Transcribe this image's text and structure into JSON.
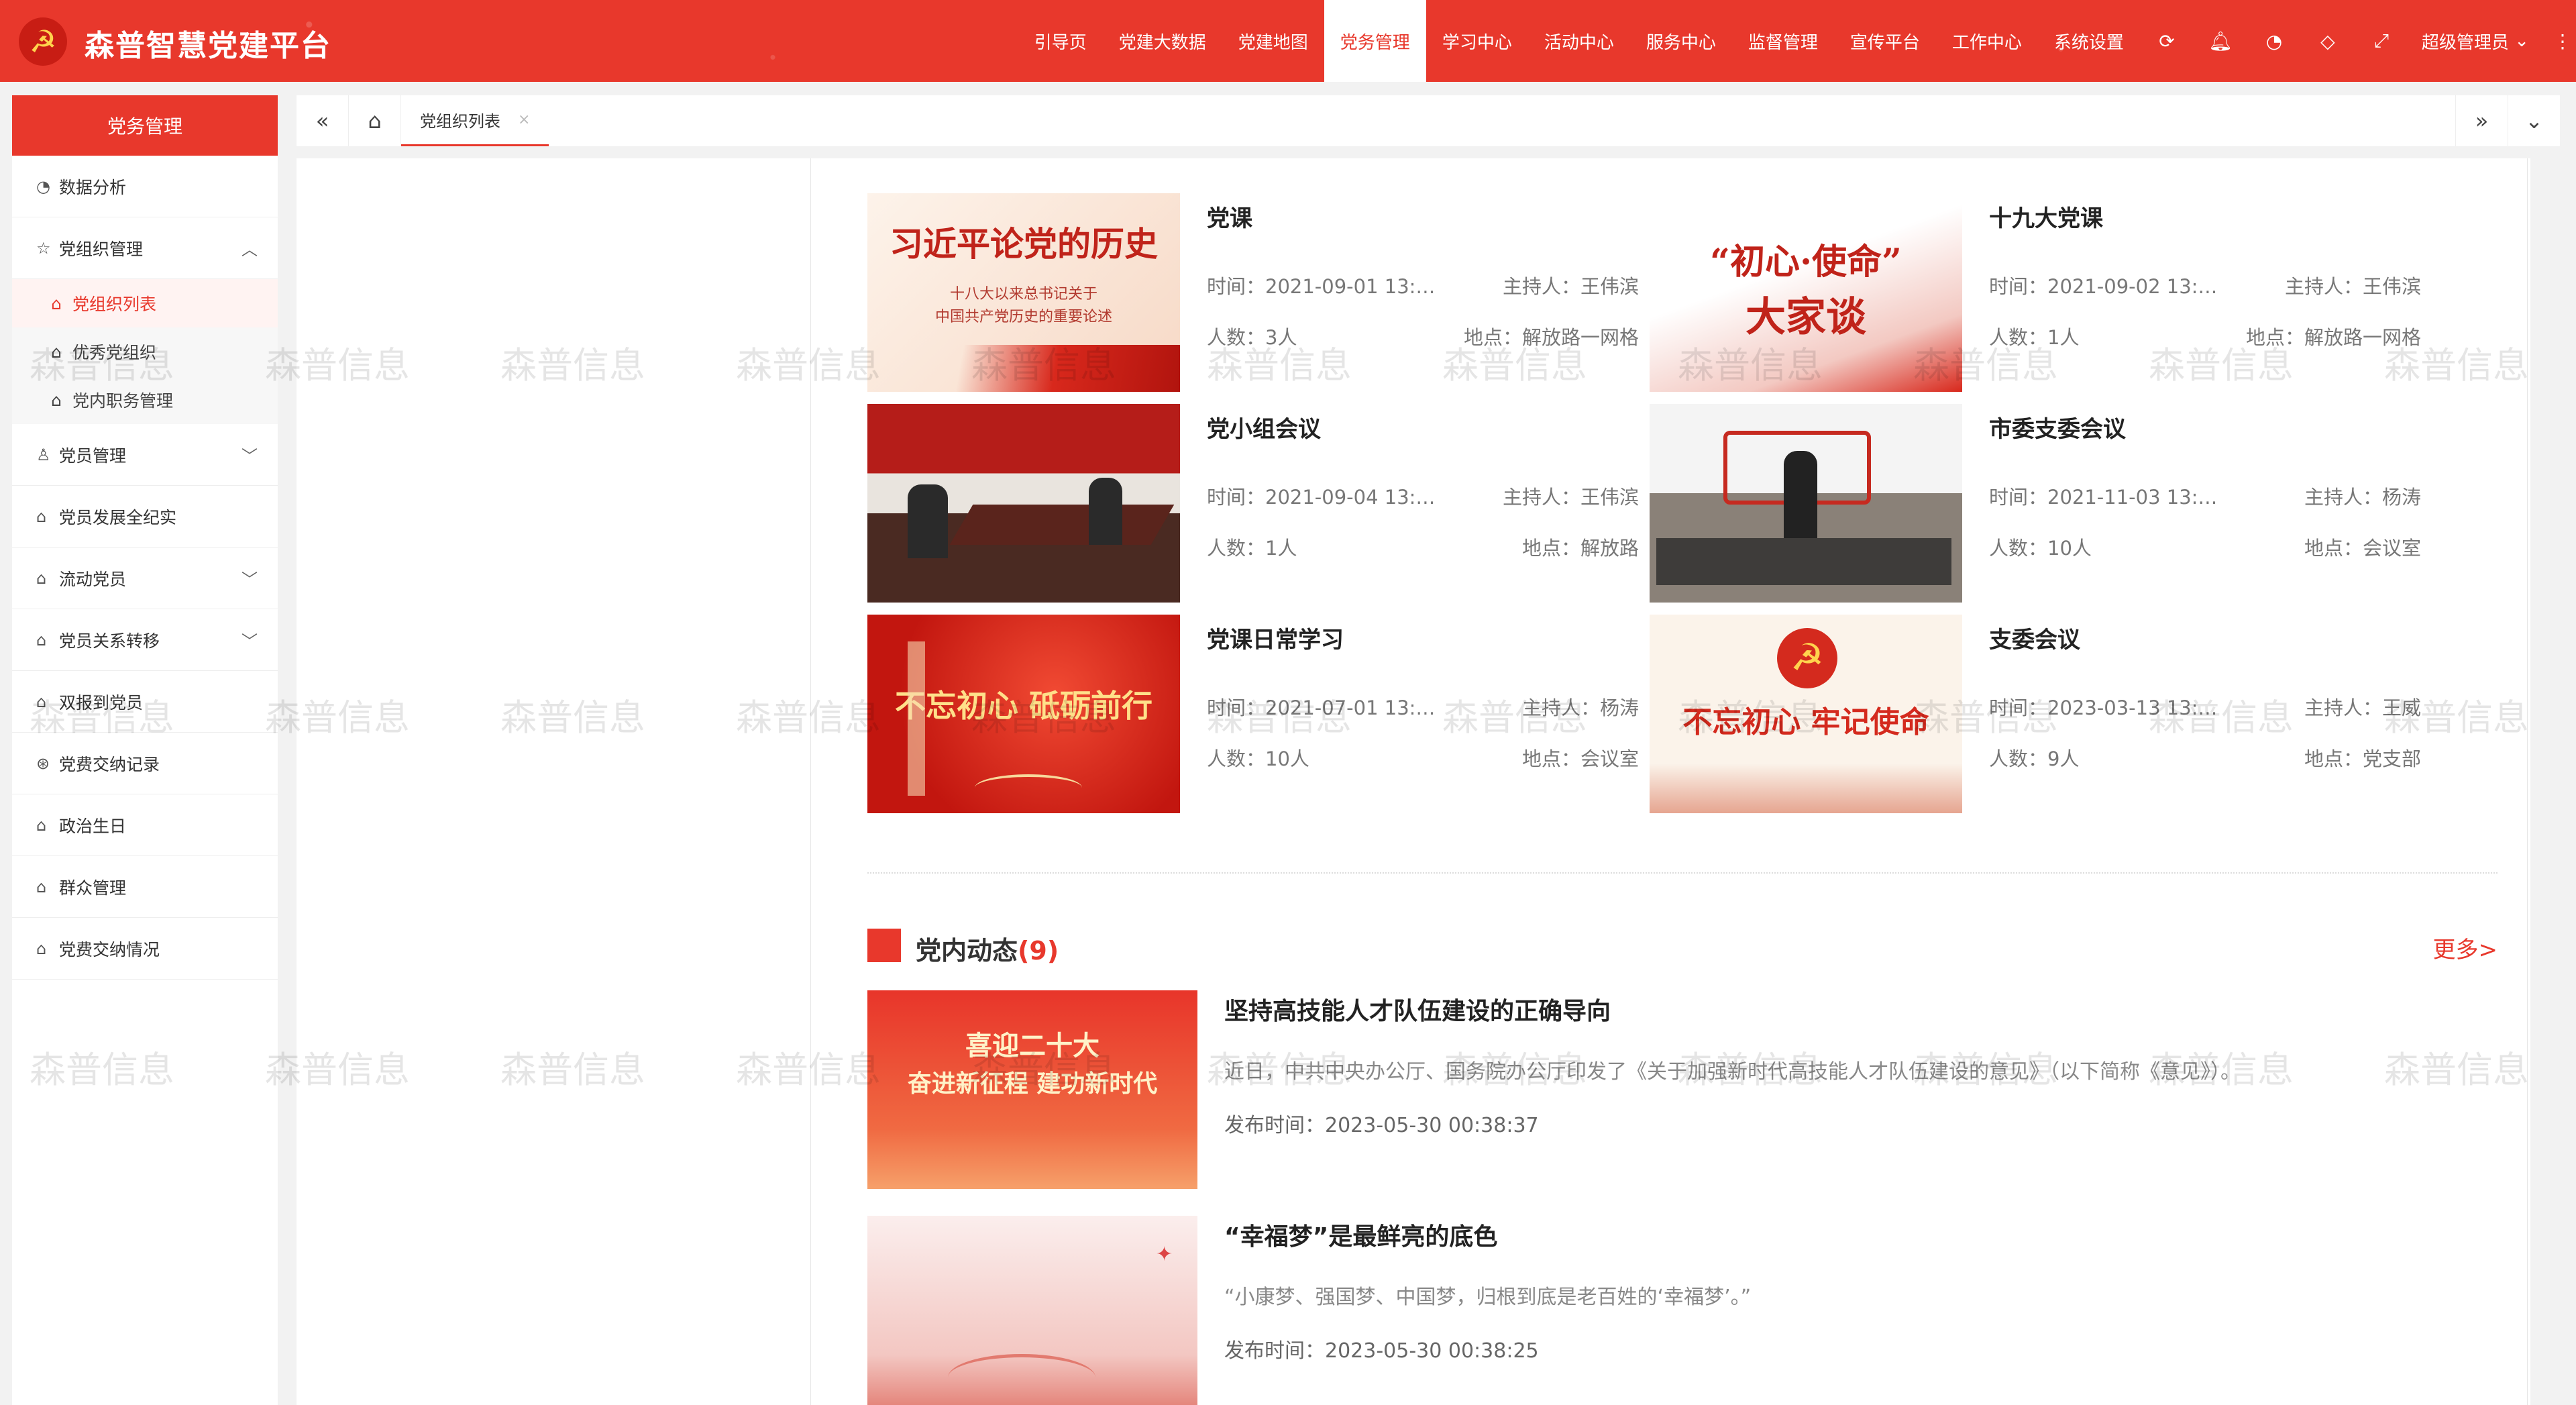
{
  "app": {
    "title": "森普智慧党建平台"
  },
  "topnav": {
    "items": [
      "引导页",
      "党建大数据",
      "党建地图",
      "党务管理",
      "学习中心",
      "活动中心",
      "服务中心",
      "监督管理",
      "宣传平台",
      "工作中心",
      "系统设置"
    ],
    "active": "党务管理",
    "icons": [
      "refresh-icon",
      "bell-icon",
      "palette-icon",
      "tag-icon",
      "fullscreen-icon"
    ],
    "user": "超级管理员"
  },
  "sidebar": {
    "header": "党务管理",
    "items": [
      {
        "label": "数据分析",
        "icon": "chart-icon"
      },
      {
        "label": "党组织管理",
        "icon": "star-icon",
        "expanded": true,
        "children": [
          {
            "label": "党组织列表",
            "active": true
          },
          {
            "label": "优秀党组织"
          },
          {
            "label": "党内职务管理"
          }
        ]
      },
      {
        "label": "党员管理",
        "icon": "person-icon",
        "chevron": true
      },
      {
        "label": "党员发展全纪实",
        "icon": "home-icon"
      },
      {
        "label": "流动党员",
        "icon": "home-icon",
        "chevron": true
      },
      {
        "label": "党员关系转移",
        "icon": "home-icon",
        "chevron": true
      },
      {
        "label": "双报到党员",
        "icon": "home-icon"
      },
      {
        "label": "党费交纳记录",
        "icon": "coin-icon"
      },
      {
        "label": "政治生日",
        "icon": "home-icon"
      },
      {
        "label": "群众管理",
        "icon": "home-icon"
      },
      {
        "label": "党费交纳情况",
        "icon": "home-icon"
      }
    ]
  },
  "tabbar": {
    "tabs": [
      {
        "label": "党组织列表"
      }
    ]
  },
  "cards": [
    {
      "title": "党课",
      "time": "时间：2021-09-01 13:…",
      "host": "主持人：王伟滨",
      "count": "人数：3人",
      "place": "地点：解放路一网格",
      "thumb": {
        "big": "习近平论党的历史",
        "small1": "十八大以来总书记关于",
        "small2": "中国共产党历史的重要论述"
      }
    },
    {
      "title": "十九大党课",
      "time": "时间：2021-09-02 13:…",
      "host": "主持人：王伟滨",
      "count": "人数：1人",
      "place": "地点：解放路一网格",
      "thumb": {
        "big1": "“初心·使命”",
        "big2": "大家谈"
      }
    },
    {
      "title": "党小组会议",
      "time": "时间：2021-09-04 13:…",
      "host": "主持人：王伟滨",
      "count": "人数：1人",
      "place": "地点：解放路"
    },
    {
      "title": "市委支委会议",
      "time": "时间：2021-11-03 13:…",
      "host": "主持人：杨涛",
      "count": "人数：10人",
      "place": "地点：会议室"
    },
    {
      "title": "党课日常学习",
      "time": "时间：2021-07-01 13:…",
      "host": "主持人：杨涛",
      "count": "人数：10人",
      "place": "地点：会议室",
      "thumb": {
        "big": "不忘初心 砥砺前行"
      }
    },
    {
      "title": "支委会议",
      "time": "时间：2023-03-13 13:…",
      "host": "主持人：王威",
      "count": "人数：9人",
      "place": "地点：党支部",
      "thumb": {
        "big": "不忘初心 牢记使命"
      }
    }
  ],
  "news_section": {
    "title": "党内动态",
    "count": "(9)",
    "more": "更多>"
  },
  "news": [
    {
      "title": "坚持高技能人才队伍建设的正确导向",
      "desc": "近日，中共中央办公厅、国务院办公厅印发了《关于加强新时代高技能人才队伍建设的意见》（以下简称《意见》）。",
      "date": "发布时间：2023-05-30 00:38:37",
      "thumb": {
        "line1": "喜迎二十大",
        "line2": "奋进新征程 建功新时代"
      }
    },
    {
      "title": "“幸福梦”是最鲜亮的底色",
      "desc": "“小康梦、强国梦、中国梦，归根到底是老百姓的‘幸福梦’。”",
      "date": "发布时间：2023-05-30 00:38:25"
    }
  ],
  "watermark": "森普信息"
}
